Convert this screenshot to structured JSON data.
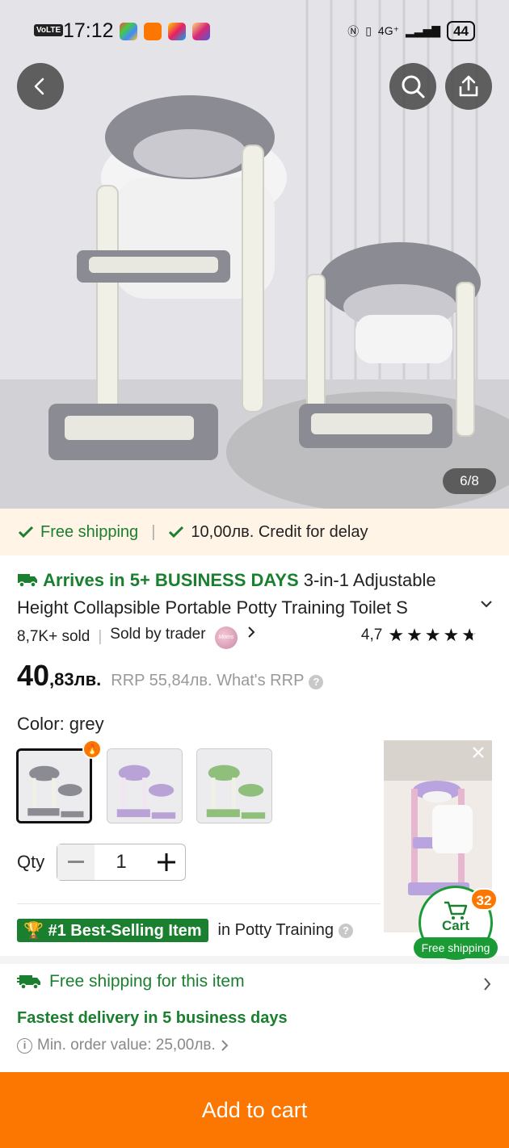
{
  "status_bar": {
    "time": "17:12",
    "volte": "VoLTE",
    "network": "4G⁺",
    "battery": "44"
  },
  "hero": {
    "image_counter": "6/8"
  },
  "shipping_strip": {
    "free_shipping": "Free shipping",
    "credit": "10,00лв. Credit for delay"
  },
  "product": {
    "arrives": "Arrives in 5+ BUSINESS DAYS",
    "title": "3-in-1 Adjustable Height Collapsible Portable Potty Training Toilet S",
    "sold": "8,7K+ sold",
    "sold_by": "Sold by trader",
    "seller_logo_text": "Moms",
    "rating": "4,7",
    "stars": 4.7,
    "price_main": "40",
    "price_fraction": ",83лв.",
    "rrp": "RRP 55,84лв. What's RRP"
  },
  "color": {
    "label": "Color: grey",
    "swatches": [
      "grey",
      "purple",
      "green"
    ]
  },
  "quantity": {
    "label": "Qty",
    "value": "1"
  },
  "best_selling": {
    "badge": "#1 Best-Selling Item",
    "category": "in Potty Training"
  },
  "shipping_info": {
    "free_for_item": "Free shipping for this item",
    "fastest": "Fastest delivery in 5 business days",
    "min_order": "Min. order value: 25,00лв."
  },
  "cart_float": {
    "label": "Cart",
    "count": "32",
    "free_shipping": "Free shipping"
  },
  "add_to_cart": "Add to cart",
  "colors": {
    "accent_orange": "#fb7701",
    "green": "#1a7f2e",
    "strip_bg": "#fff4e6"
  }
}
